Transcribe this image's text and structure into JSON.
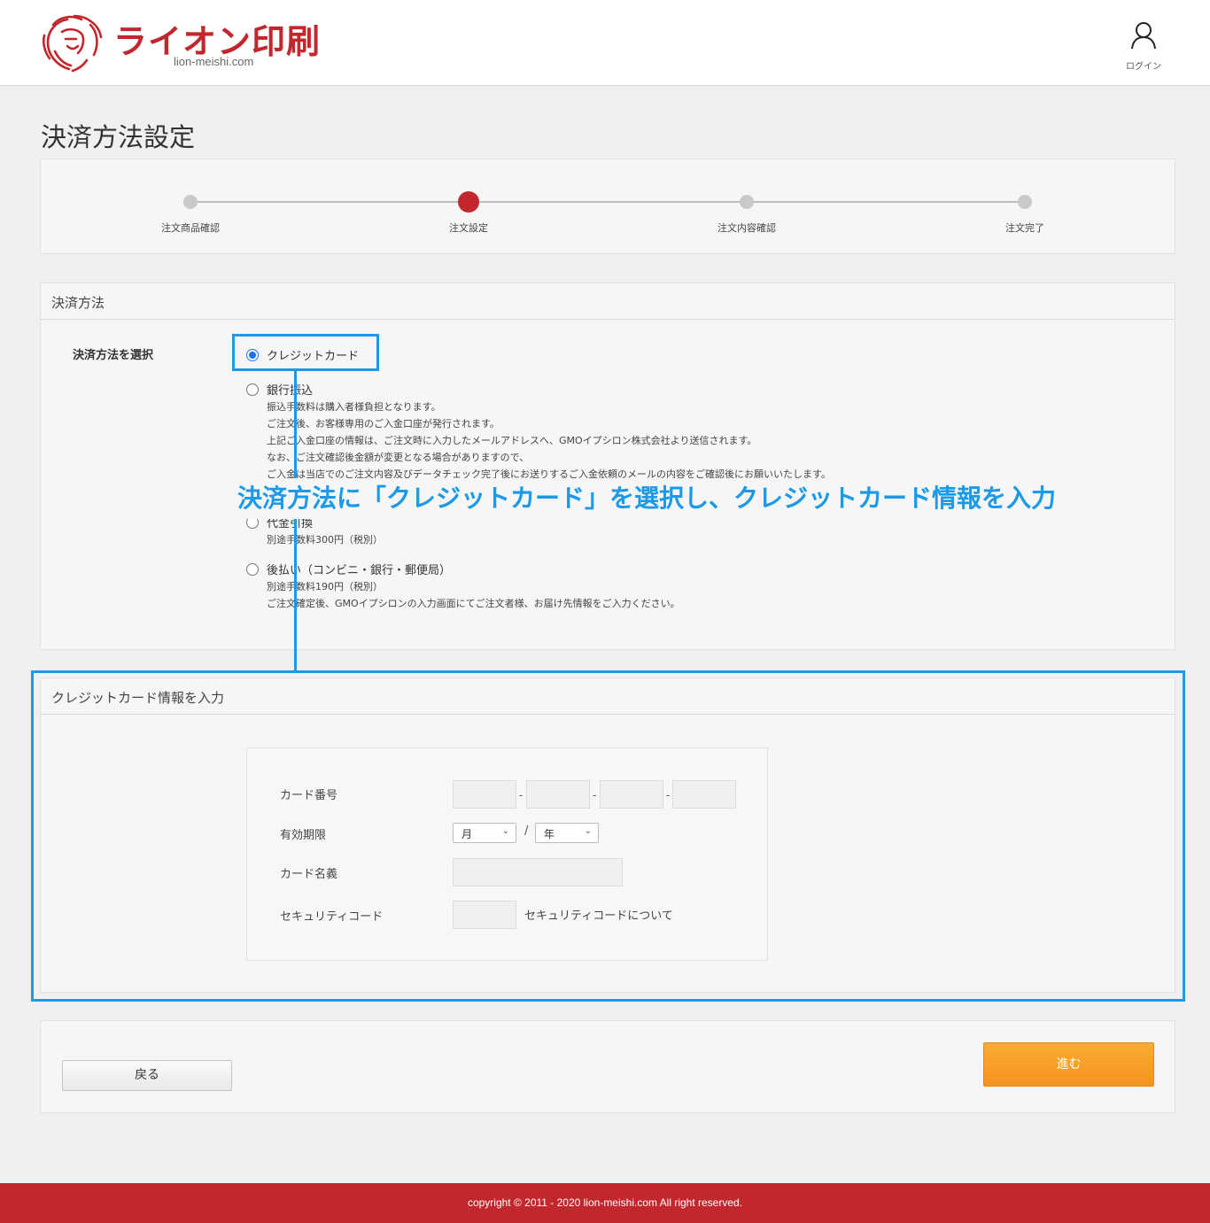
{
  "header": {
    "brand": "ライオン印刷",
    "domain": "lion-meishi.com",
    "login_label": "ログイン"
  },
  "page_title": "決済方法設定",
  "steps": [
    {
      "label": "注文商品確認",
      "active": false
    },
    {
      "label": "注文設定",
      "active": true
    },
    {
      "label": "注文内容確認",
      "active": false
    },
    {
      "label": "注文完了",
      "active": false
    }
  ],
  "payment": {
    "heading": "決済方法",
    "select_label": "決済方法を選択",
    "options": [
      {
        "title": "クレジットカード",
        "checked": true,
        "desc": []
      },
      {
        "title": "銀行振込",
        "checked": false,
        "desc": [
          "振込手数料は購入者様負担となります。",
          "ご注文後、お客様専用のご入金口座が発行されます。",
          "上記ご入金口座の情報は、ご注文時に入力したメールアドレスへ、GMOイプシロン株式会社より送信されます。",
          "なお、ご注文確認後金額が変更となる場合がありますので、",
          "ご入金は当店でのご注文内容及びデータチェック完了後にお送りするご入金依頼のメールの内容をご確認後にお願いいたします。"
        ]
      },
      {
        "title": "代金引換",
        "checked": false,
        "desc": [
          "別途手数料300円（税別）"
        ]
      },
      {
        "title": "後払い（コンビニ・銀行・郵便局）",
        "checked": false,
        "desc": [
          "別途手数料190円（税別）",
          "ご注文確定後、GMOイプシロンの入力画面にてご注文者様、お届け先情報をご入力ください。"
        ]
      }
    ]
  },
  "card": {
    "heading": "クレジットカード情報を入力",
    "number_label": "カード番号",
    "number_separator": "-",
    "expiry_label": "有効期限",
    "month_value": "月",
    "year_value": "年",
    "expiry_separator": "/",
    "name_label": "カード名義",
    "security_label": "セキュリティコード",
    "security_link": "セキュリティコードについて"
  },
  "actions": {
    "back": "戻る",
    "next": "進む"
  },
  "annotation": {
    "callout": "決済方法に「クレジットカード」を選択し、クレジットカード情報を入力",
    "color": "#1a9ae8"
  },
  "footer": {
    "copyright": "copyright © 2011 - 2020 lion-meishi.com All right reserved."
  },
  "colors": {
    "brand": "#c1272d",
    "accent_orange": "#f6931e",
    "radio_selected": "#1a73e8"
  }
}
